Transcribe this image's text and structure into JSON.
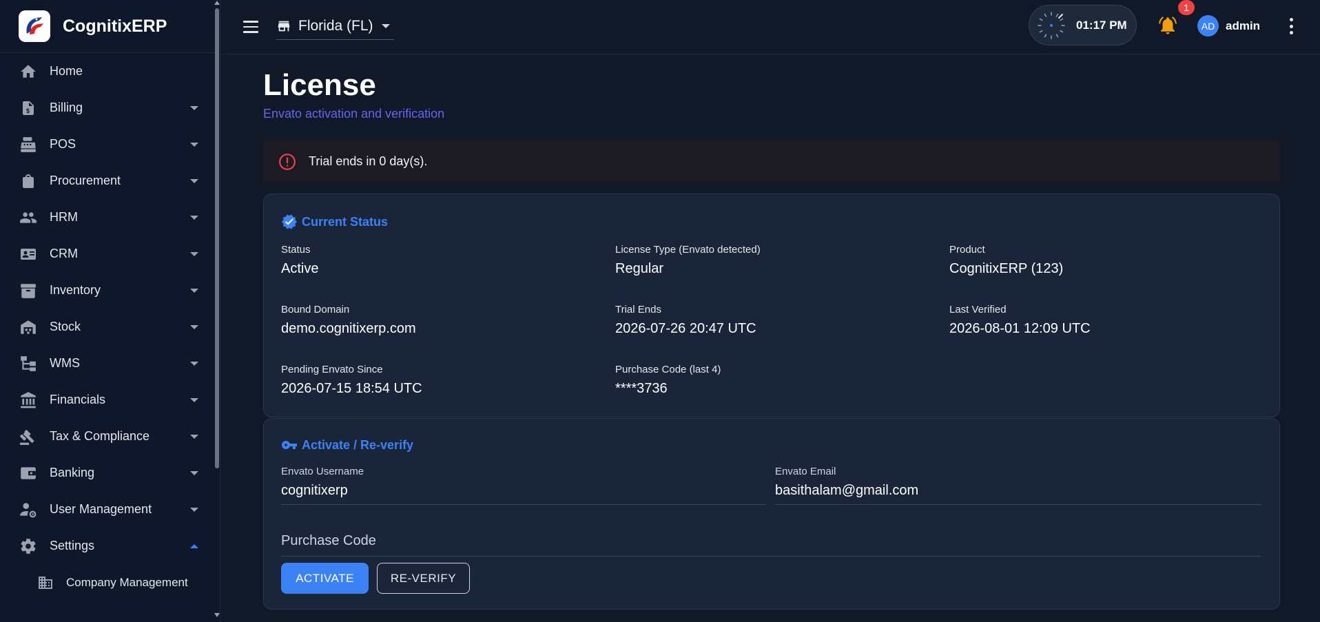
{
  "brand": {
    "name": "CognitixERP"
  },
  "sidebar": {
    "items": [
      {
        "label": "Home",
        "icon": "home-icon",
        "expandable": false
      },
      {
        "label": "Billing",
        "icon": "invoice-icon",
        "expandable": true
      },
      {
        "label": "POS",
        "icon": "cash-register-icon",
        "expandable": true
      },
      {
        "label": "Procurement",
        "icon": "shopping-bag-icon",
        "expandable": true
      },
      {
        "label": "HRM",
        "icon": "people-icon",
        "expandable": true
      },
      {
        "label": "CRM",
        "icon": "contact-card-icon",
        "expandable": true
      },
      {
        "label": "Inventory",
        "icon": "archive-icon",
        "expandable": true
      },
      {
        "label": "Stock",
        "icon": "warehouse-icon",
        "expandable": true
      },
      {
        "label": "WMS",
        "icon": "hierarchy-icon",
        "expandable": true
      },
      {
        "label": "Financials",
        "icon": "bank-icon",
        "expandable": true
      },
      {
        "label": "Tax & Compliance",
        "icon": "gavel-icon",
        "expandable": true
      },
      {
        "label": "Banking",
        "icon": "wallet-icon",
        "expandable": true
      },
      {
        "label": "User Management",
        "icon": "user-gear-icon",
        "expandable": true
      },
      {
        "label": "Settings",
        "icon": "gear-icon",
        "expandable": true,
        "expanded": true
      }
    ],
    "sub_items": [
      {
        "label": "Company Management",
        "icon": "building-icon"
      }
    ]
  },
  "topbar": {
    "store": "Florida (FL)",
    "time": "01:17 PM",
    "notifications": "1",
    "avatar_initials": "AD",
    "user": "admin"
  },
  "page": {
    "title": "License",
    "subtitle": "Envato activation and verification"
  },
  "alert": {
    "text": "Trial ends in 0 day(s)."
  },
  "status_card": {
    "title": "Current Status",
    "fields": [
      {
        "label": "Status",
        "value": "Active"
      },
      {
        "label": "License Type (Envato detected)",
        "value": "Regular"
      },
      {
        "label": "Product",
        "value": "CognitixERP (123)"
      },
      {
        "label": "Bound Domain",
        "value": "demo.cognitixerp.com"
      },
      {
        "label": "Trial Ends",
        "value": "2026-07-26 20:47 UTC"
      },
      {
        "label": "Last Verified",
        "value": "2026-08-01 12:09 UTC"
      },
      {
        "label": "Pending Envato Since",
        "value": "2026-07-15 18:54 UTC"
      },
      {
        "label": "Purchase Code (last 4)",
        "value": "****3736"
      }
    ]
  },
  "activate_card": {
    "title": "Activate / Re-verify",
    "username_label": "Envato Username",
    "username_value": "cognitixerp",
    "email_label": "Envato Email",
    "email_value": "basithalam@gmail.com",
    "purchase_code_placeholder": "Purchase Code",
    "activate_label": "ACTIVATE",
    "reverify_label": "RE-VERIFY"
  },
  "colors": {
    "accent": "#3b82f6",
    "subtitle": "#6366f1",
    "alert_icon": "#ef4444",
    "bell": "#f59e0b",
    "background": "#111827",
    "card": "#1b2539"
  }
}
